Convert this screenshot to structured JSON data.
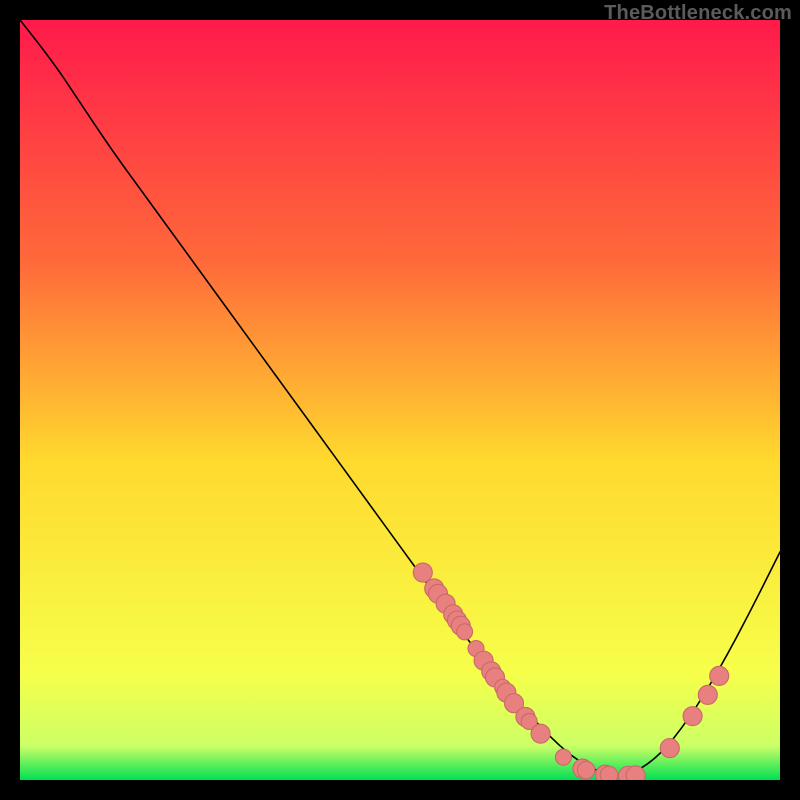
{
  "brand": "TheBottleneck.com",
  "colors": {
    "gradient_top": "#ff1a4b",
    "gradient_mid_upper": "#ff6a3a",
    "gradient_mid": "#ffd92e",
    "gradient_lower": "#f6ff4a",
    "gradient_band": "#ccff66",
    "gradient_bottom": "#00e053",
    "curve": "#000000",
    "dot_fill": "#e98080",
    "dot_stroke": "#c86a6a",
    "background": "#000000"
  },
  "chart_data": {
    "type": "line",
    "title": "",
    "xlabel": "",
    "ylabel": "",
    "xlim": [
      0,
      100
    ],
    "ylim": [
      0,
      100
    ],
    "grid": false,
    "legend": false,
    "series": [
      {
        "name": "bottleneck-curve",
        "x": [
          0,
          4,
          8,
          12,
          16,
          20,
          24,
          28,
          32,
          36,
          40,
          44,
          48,
          52,
          56,
          60,
          64,
          68,
          72,
          76,
          80,
          84,
          88,
          92,
          96,
          100
        ],
        "y": [
          100,
          95,
          89,
          83,
          77.5,
          72,
          66.5,
          61,
          55.5,
          50,
          44.5,
          39,
          33.5,
          28,
          22.5,
          17,
          12,
          7.5,
          3.5,
          1,
          0.5,
          3,
          8,
          14.5,
          22,
          30
        ]
      }
    ],
    "markers": [
      {
        "x": 53.0,
        "y": 27.3,
        "r": 1.25
      },
      {
        "x": 54.5,
        "y": 25.2,
        "r": 1.25
      },
      {
        "x": 55.0,
        "y": 24.5,
        "r": 1.25
      },
      {
        "x": 56.0,
        "y": 23.2,
        "r": 1.25
      },
      {
        "x": 57.0,
        "y": 21.8,
        "r": 1.25
      },
      {
        "x": 57.5,
        "y": 21.0,
        "r": 1.25
      },
      {
        "x": 58.0,
        "y": 20.3,
        "r": 1.25
      },
      {
        "x": 58.5,
        "y": 19.5,
        "r": 1.05
      },
      {
        "x": 60.0,
        "y": 17.3,
        "r": 1.05
      },
      {
        "x": 61.0,
        "y": 15.7,
        "r": 1.25
      },
      {
        "x": 62.0,
        "y": 14.3,
        "r": 1.25
      },
      {
        "x": 62.5,
        "y": 13.5,
        "r": 1.25
      },
      {
        "x": 63.5,
        "y": 12.2,
        "r": 1.05
      },
      {
        "x": 64.0,
        "y": 11.5,
        "r": 1.25
      },
      {
        "x": 65.0,
        "y": 10.1,
        "r": 1.25
      },
      {
        "x": 66.5,
        "y": 8.3,
        "r": 1.25
      },
      {
        "x": 67.0,
        "y": 7.7,
        "r": 1.05
      },
      {
        "x": 68.5,
        "y": 6.1,
        "r": 1.25
      },
      {
        "x": 71.5,
        "y": 3.0,
        "r": 1.05
      },
      {
        "x": 74.0,
        "y": 1.5,
        "r": 1.25
      },
      {
        "x": 74.5,
        "y": 1.3,
        "r": 1.15
      },
      {
        "x": 77.0,
        "y": 0.7,
        "r": 1.25
      },
      {
        "x": 77.5,
        "y": 0.65,
        "r": 1.15
      },
      {
        "x": 80.0,
        "y": 0.55,
        "r": 1.25
      },
      {
        "x": 81.0,
        "y": 0.6,
        "r": 1.25
      },
      {
        "x": 85.5,
        "y": 4.2,
        "r": 1.25
      },
      {
        "x": 88.5,
        "y": 8.4,
        "r": 1.25
      },
      {
        "x": 90.5,
        "y": 11.2,
        "r": 1.25
      },
      {
        "x": 92.0,
        "y": 13.7,
        "r": 1.25
      }
    ]
  }
}
